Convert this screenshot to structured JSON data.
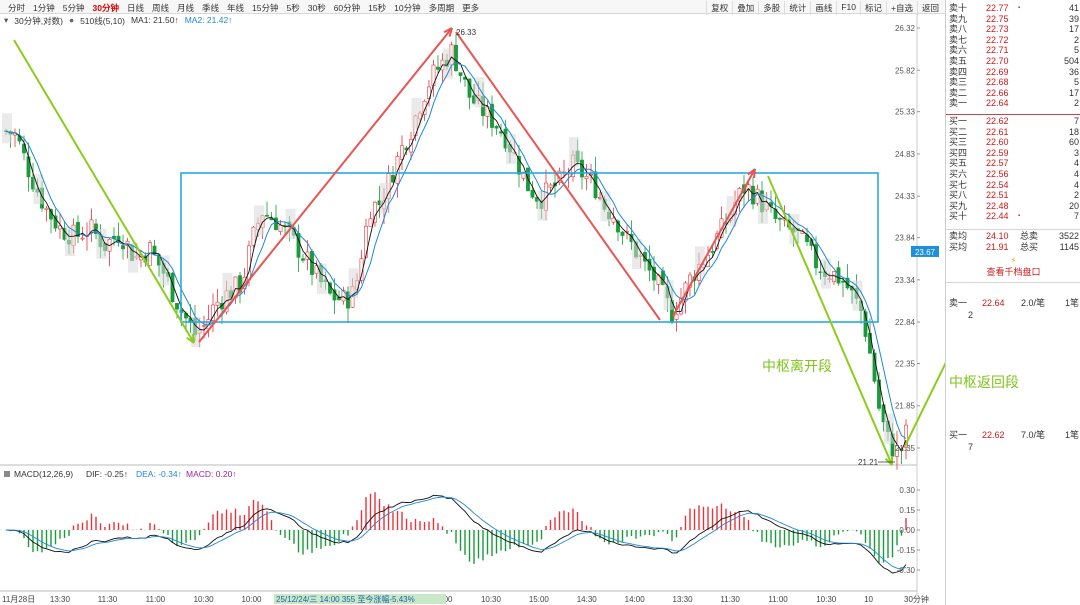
{
  "toolbar": {
    "periods": [
      "分时",
      "1分钟",
      "5分钟",
      "30分钟",
      "日线",
      "周线",
      "月线",
      "季线",
      "年线",
      "15分钟",
      "5秒",
      "30秒",
      "60分钟",
      "15秒",
      "10分钟",
      "多周期",
      "更多"
    ],
    "active_period": "30分钟",
    "right_tools": [
      "复权",
      "叠加",
      "多股",
      "统计",
      "画线",
      "F10",
      "标记",
      "+自选",
      "返回"
    ]
  },
  "legend": {
    "main": "30分钟,对数)",
    "indicator": "510线(5,10)",
    "ma1": "MA1: 21.50↑",
    "ma2": "MA2: 21.42↑"
  },
  "price_axis": {
    "ticks": [
      "26.32",
      "25.82",
      "25.33",
      "24.83",
      "24.33",
      "23.84",
      "23.34",
      "22.84",
      "22.35",
      "21.85",
      "21.35"
    ],
    "current_badge": "23.67",
    "current_badge_color": "#1e8fd8"
  },
  "chart_labels": {
    "high_label": "26.33",
    "low_label": "21.21",
    "annotation_leave": "中枢离开段",
    "annotation_return": "中枢返回段",
    "cursor_info": "25/12/24/三 14:00 355 至今涨幅-5.43%"
  },
  "macd": {
    "legend_name": "MACD(12,26,9)",
    "dif": "DIF: -0.25↑",
    "dea": "DEA: -0.34↑",
    "macd": "MACD: 0.20↑",
    "ticks": [
      "0.30",
      "0.15",
      "0.00",
      "-0.15",
      "-0.30"
    ]
  },
  "time_axis": {
    "labels": [
      "11月28日",
      "13:30",
      "11:30",
      "11:00",
      "10:30",
      "10:00",
      "15:",
      "10:00",
      "11:30",
      "11:00",
      "10:30",
      "15:00",
      "14:30",
      "14:00",
      "13:30",
      "11:30",
      "11:00",
      "10:30",
      "10",
      "30分钟"
    ]
  },
  "colors": {
    "up": "#e8333a",
    "down": "#1a9b3a",
    "ma1": "#111111",
    "ma2": "#1e88d8",
    "box": "#29a9e0",
    "arrow_red": "#e85555",
    "arrow_green": "#8ccc1c"
  },
  "order_book": {
    "asks": [
      {
        "label": "卖十",
        "price": "22.77",
        "qty": "41",
        "mark": "▪"
      },
      {
        "label": "卖九",
        "price": "22.75",
        "qty": "39",
        "mark": ""
      },
      {
        "label": "卖八",
        "price": "22.73",
        "qty": "17",
        "mark": ""
      },
      {
        "label": "卖七",
        "price": "22.72",
        "qty": "2",
        "mark": ""
      },
      {
        "label": "卖六",
        "price": "22.71",
        "qty": "5",
        "mark": ""
      },
      {
        "label": "卖五",
        "price": "22.70",
        "qty": "504",
        "mark": ""
      },
      {
        "label": "卖四",
        "price": "22.69",
        "qty": "36",
        "mark": ""
      },
      {
        "label": "卖三",
        "price": "22.68",
        "qty": "5",
        "mark": ""
      },
      {
        "label": "卖二",
        "price": "22.66",
        "qty": "17",
        "mark": ""
      },
      {
        "label": "卖一",
        "price": "22.64",
        "qty": "2",
        "mark": ""
      }
    ],
    "bids": [
      {
        "label": "买一",
        "price": "22.62",
        "qty": "7",
        "mark": ""
      },
      {
        "label": "买二",
        "price": "22.61",
        "qty": "18",
        "mark": ""
      },
      {
        "label": "买三",
        "price": "22.60",
        "qty": "60",
        "mark": ""
      },
      {
        "label": "买四",
        "price": "22.59",
        "qty": "3",
        "mark": ""
      },
      {
        "label": "买五",
        "price": "22.57",
        "qty": "4",
        "mark": ""
      },
      {
        "label": "买六",
        "price": "22.56",
        "qty": "4",
        "mark": ""
      },
      {
        "label": "买七",
        "price": "22.54",
        "qty": "4",
        "mark": ""
      },
      {
        "label": "买八",
        "price": "22.51",
        "qty": "2",
        "mark": ""
      },
      {
        "label": "买九",
        "price": "22.48",
        "qty": "20",
        "mark": ""
      },
      {
        "label": "买十",
        "price": "22.44",
        "qty": "7",
        "mark": "▪"
      }
    ],
    "avg_sell_label": "卖均",
    "avg_sell": "24.10",
    "total_sell_label": "总卖",
    "total_sell": "3522",
    "avg_buy_label": "买均",
    "avg_buy": "21.91",
    "total_buy_label": "总买",
    "total_buy": "1145",
    "level2_link": "查看千档盘口",
    "trade_sell": {
      "label": "卖一",
      "price": "22.64",
      "qty": "2.0/笔",
      "count": "1笔",
      "sub": "2"
    },
    "trade_buy": {
      "label": "买一",
      "price": "22.62",
      "qty": "7.0/笔",
      "count": "1笔",
      "sub": "7"
    }
  }
}
